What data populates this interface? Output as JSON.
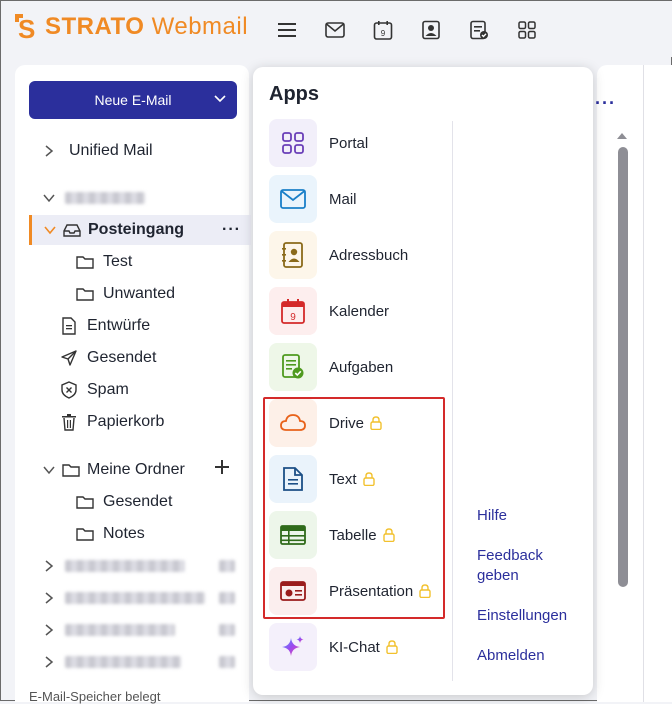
{
  "header": {
    "brand": "STRATO",
    "product": "Webmail",
    "icons": [
      "menu-icon",
      "mail-icon",
      "calendar-icon",
      "contacts-icon",
      "tasks-icon",
      "apps-grid-icon"
    ],
    "calendar_day": "9"
  },
  "sidebar": {
    "compose_label": "Neue E-Mail",
    "unified_mail": "Unified Mail",
    "inbox": "Posteingang",
    "folders": [
      "Test",
      "Unwanted"
    ],
    "system": [
      "Entwürfe",
      "Gesendet",
      "Spam",
      "Papierkorb"
    ],
    "my_folders": "Meine Ordner",
    "my_folders_children": [
      "Gesendet",
      "Notes"
    ],
    "footer": "E-Mail-Speicher belegt"
  },
  "apps": {
    "title": "Apps",
    "items": [
      {
        "label": "Portal",
        "icon": "portal-grid-icon",
        "locked": false
      },
      {
        "label": "Mail",
        "icon": "mail-icon",
        "locked": false
      },
      {
        "label": "Adressbuch",
        "icon": "address-book-icon",
        "locked": false
      },
      {
        "label": "Kalender",
        "icon": "calendar-icon",
        "locked": false
      },
      {
        "label": "Aufgaben",
        "icon": "tasks-icon",
        "locked": false
      },
      {
        "label": "Drive",
        "icon": "cloud-icon",
        "locked": true
      },
      {
        "label": "Text",
        "icon": "document-icon",
        "locked": true
      },
      {
        "label": "Tabelle",
        "icon": "spreadsheet-icon",
        "locked": true
      },
      {
        "label": "Präsentation",
        "icon": "presentation-icon",
        "locked": true
      },
      {
        "label": "KI-Chat",
        "icon": "sparkle-icon",
        "locked": true
      }
    ],
    "links": [
      "Hilfe",
      "Feedback geben",
      "Einstellungen",
      "Abmelden"
    ]
  },
  "colors": {
    "brand_orange": "#f08a24",
    "primary_blue": "#2b2f9c",
    "lock_yellow": "#f2c12e",
    "highlight_red": "#d42a2a"
  }
}
